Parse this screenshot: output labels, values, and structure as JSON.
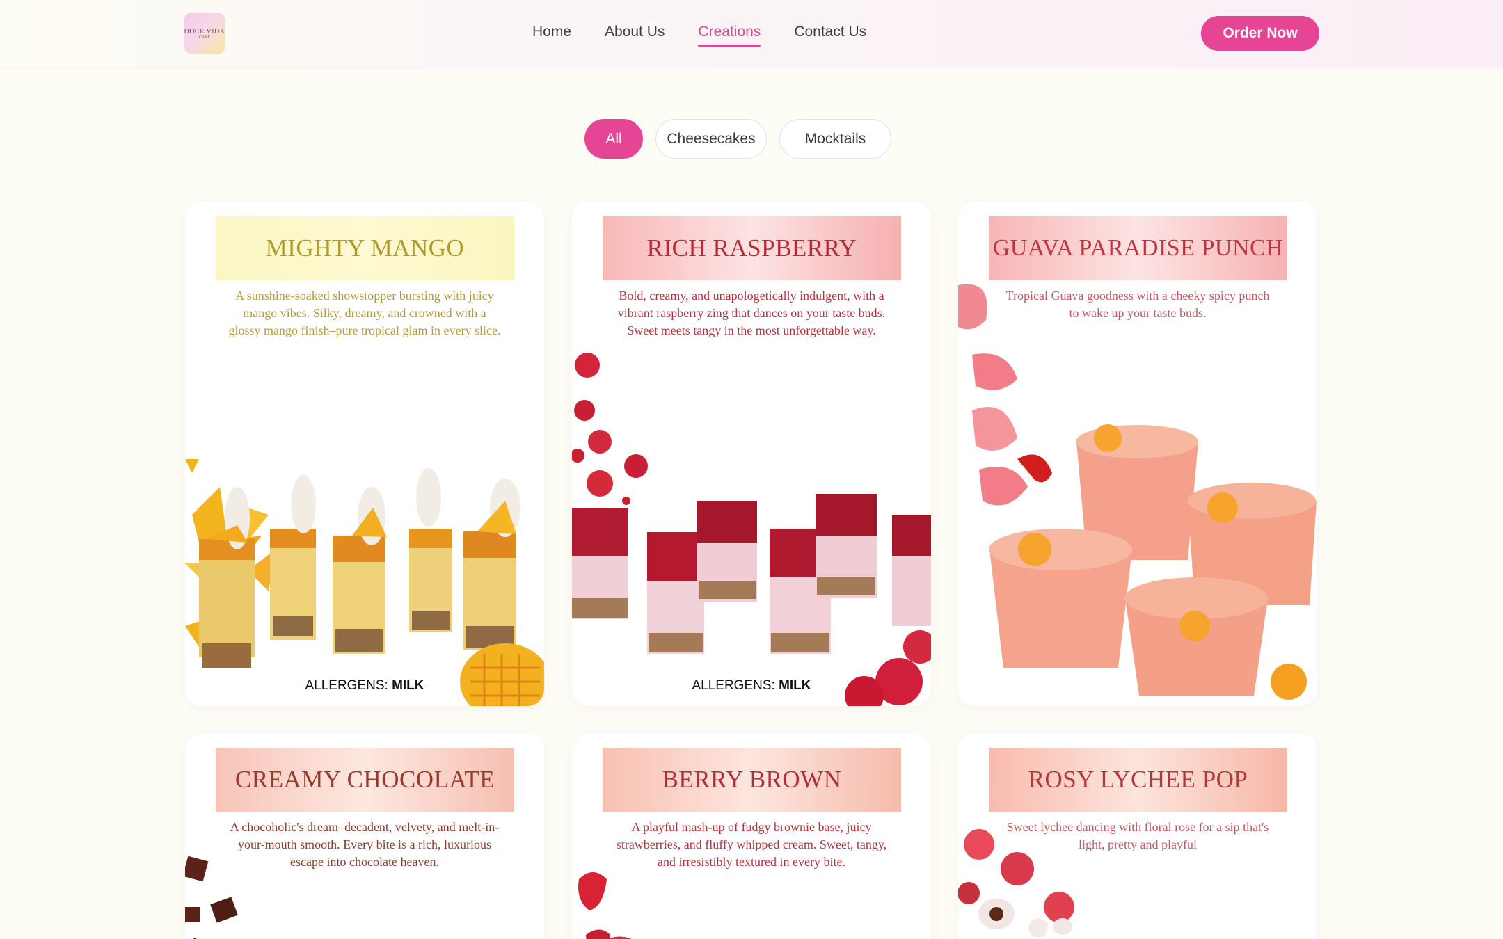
{
  "brand": {
    "logo_text": "DOCE VIDA",
    "logo_sub": "CAKE"
  },
  "nav": {
    "items": [
      {
        "label": "Home"
      },
      {
        "label": "About Us"
      },
      {
        "label": "Creations",
        "active": true
      },
      {
        "label": "Contact Us"
      }
    ]
  },
  "header": {
    "order_label": "Order Now"
  },
  "filters": {
    "items": [
      {
        "label": "All",
        "active": true
      },
      {
        "label": "Cheesecakes"
      },
      {
        "label": "Mocktails"
      }
    ]
  },
  "allergen_prefix": "ALLERGENS:",
  "cards": [
    {
      "title": "MIGHTY MANGO",
      "description": "A sunshine-soaked showstopper bursting with juicy mango vibes. Silky, dreamy, and crowned with a glossy mango finish–pure tropical glam in every slice.",
      "allergen": "MILK"
    },
    {
      "title": "RICH RASPBERRY",
      "description": "Bold, creamy, and unapologetically indulgent, with a vibrant raspberry zing that dances on your taste buds. Sweet meets tangy in the most unforgettable way.",
      "allergen": "MILK"
    },
    {
      "title": "GUAVA PARADISE PUNCH",
      "description": "Tropical Guava goodness with a cheeky spicy punch to wake up your taste buds."
    },
    {
      "title": "CREAMY CHOCOLATE",
      "description": "A chocoholic's dream–decadent, velvety, and melt-in-your-mouth smooth. Every bite is a rich, luxurious escape into chocolate heaven."
    },
    {
      "title": "BERRY BROWN",
      "description": "A playful mash-up of fudgy brownie base, juicy strawberries, and fluffy whipped cream. Sweet, tangy, and irresistibly textured in every bite."
    },
    {
      "title": "ROSY LYCHEE POP",
      "description": "Sweet lychee dancing with floral rose for a sip that's light, pretty and playful"
    }
  ],
  "colors": {
    "accent": "#e64595",
    "background": "#fdfdf5"
  }
}
